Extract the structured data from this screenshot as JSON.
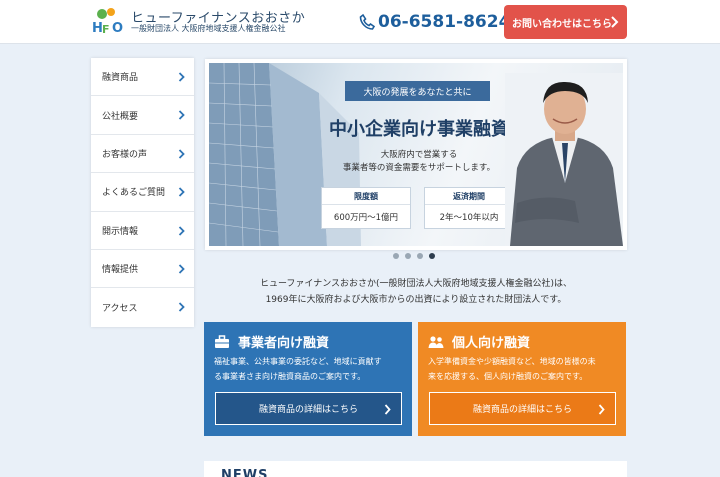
{
  "header": {
    "logo_mark": "HFO",
    "title": "ヒューファイナンスおおさか",
    "subtitle": "一般財団法人 大阪府地域支援人権金融公社",
    "phone": "06-6581-8624",
    "contact_label": "お問い合わせはこちら"
  },
  "sidebar": {
    "items": [
      {
        "label": "融資商品"
      },
      {
        "label": "公社概要"
      },
      {
        "label": "お客様の声"
      },
      {
        "label": "よくあるご質問"
      },
      {
        "label": "開示情報"
      },
      {
        "label": "情報提供"
      },
      {
        "label": "アクセス"
      }
    ]
  },
  "hero": {
    "tagline": "大阪の発展をあなたと共に",
    "title": "中小企業向け事業融資",
    "desc_line1": "大阪府内で営業する",
    "desc_line2": "事業者等の資金需要をサポートします。",
    "limit_label": "限度額",
    "limit_value": "600万円〜1億円",
    "period_label": "返済期間",
    "period_value": "2年〜10年以内",
    "slide_count": 4,
    "active_slide": 4
  },
  "intro": {
    "line1": "ヒューファイナンスおおさか(一般財団法人大阪府地域支援人権金融公社)は、",
    "line2": "1969年に大阪府および大阪市からの出資により設立された財団法人です。"
  },
  "cards": {
    "business": {
      "title": "事業者向け融資",
      "line1": "福祉事業、公共事業の委託など、地域に貢献す",
      "line2": "る事業者さま向け融資商品のご案内です。",
      "button": "融資商品の詳細はこちら"
    },
    "personal": {
      "title": "個人向け融資",
      "line1": "入学準備資金や少額融資など、地域の皆様の未",
      "line2": "来を応援する、個人向け融資のご案内です。",
      "button": "融資商品の詳細はこちら"
    }
  },
  "news": {
    "title": "NEWS"
  },
  "colors": {
    "accent_blue": "#2e74b5",
    "accent_orange": "#f08a24",
    "contact_red": "#e2534a",
    "brand_navy": "#1f3f66"
  }
}
